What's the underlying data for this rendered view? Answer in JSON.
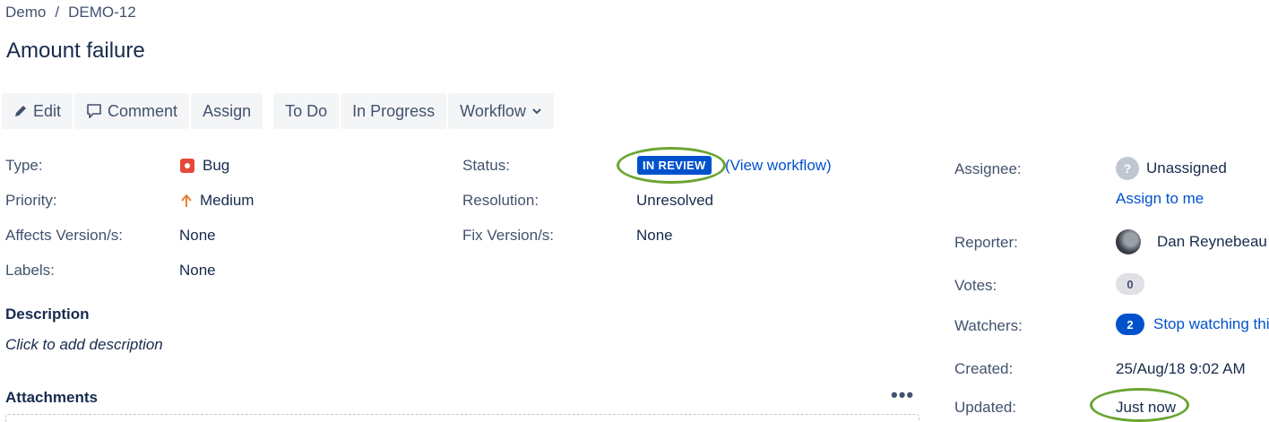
{
  "breadcrumb": {
    "project": "Demo",
    "separator": "/",
    "issue_key": "DEMO-12"
  },
  "issue": {
    "title": "Amount failure"
  },
  "toolbar": {
    "edit": "Edit",
    "comment": "Comment",
    "assign": "Assign",
    "to_do": "To Do",
    "in_progress": "In Progress",
    "workflow": "Workflow"
  },
  "details": {
    "type_label": "Type:",
    "type_value": "Bug",
    "priority_label": "Priority:",
    "priority_value": "Medium",
    "affects_label": "Affects Version/s:",
    "affects_value": "None",
    "labels_label": "Labels:",
    "labels_value": "None",
    "status_label": "Status:",
    "status_value": "IN REVIEW",
    "view_workflow": "(View workflow)",
    "resolution_label": "Resolution:",
    "resolution_value": "Unresolved",
    "fix_label": "Fix Version/s:",
    "fix_value": "None"
  },
  "description": {
    "heading": "Description",
    "placeholder": "Click to add description"
  },
  "attachments": {
    "heading": "Attachments",
    "more": "•••"
  },
  "people": {
    "assignee_label": "Assignee:",
    "assignee_value": "Unassigned",
    "assign_to_me": "Assign to me",
    "reporter_label": "Reporter:",
    "reporter_value": "Dan Reynebeau",
    "votes_label": "Votes:",
    "votes_count": "0",
    "watchers_label": "Watchers:",
    "watchers_count": "2",
    "stop_watching": "Stop watching this issue"
  },
  "dates": {
    "created_label": "Created:",
    "created_value": "25/Aug/18 9:02 AM",
    "updated_label": "Updated:",
    "updated_value": "Just now"
  },
  "colors": {
    "accent": "#0052cc",
    "highlight_ring": "#6aa532",
    "bug": "#e5493a",
    "priority_medium": "#e97f33"
  }
}
